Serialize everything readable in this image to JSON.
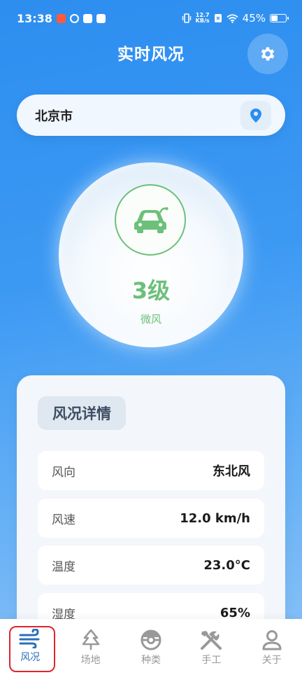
{
  "status_bar": {
    "time": "13:38",
    "net_speed_value": "12.7",
    "net_speed_unit": "KB/s",
    "battery": "45%",
    "battery_level": 0.45
  },
  "header": {
    "title": "实时风况",
    "settings_icon": "gear-icon"
  },
  "location": {
    "city": "北京市",
    "icon": "location-pin-icon"
  },
  "wind": {
    "level": "3级",
    "description": "微风",
    "icon": "car-icon",
    "accent_color": "#6cc07a"
  },
  "details": {
    "title": "风况详情",
    "rows": [
      {
        "label": "风向",
        "value": "东北风"
      },
      {
        "label": "风速",
        "value": "12.0 km/h"
      },
      {
        "label": "温度",
        "value": "23.0°C"
      },
      {
        "label": "湿度",
        "value": "65%"
      }
    ]
  },
  "nav": {
    "items": [
      {
        "label": "风况",
        "icon": "wind-icon",
        "active": true
      },
      {
        "label": "场地",
        "icon": "tree-icon",
        "active": false
      },
      {
        "label": "种类",
        "icon": "pokeball-icon",
        "active": false
      },
      {
        "label": "手工",
        "icon": "tools-icon",
        "active": false
      },
      {
        "label": "关于",
        "icon": "person-icon",
        "active": false
      }
    ],
    "active_color": "#2b6fb8",
    "highlight_color": "#e0242b"
  }
}
